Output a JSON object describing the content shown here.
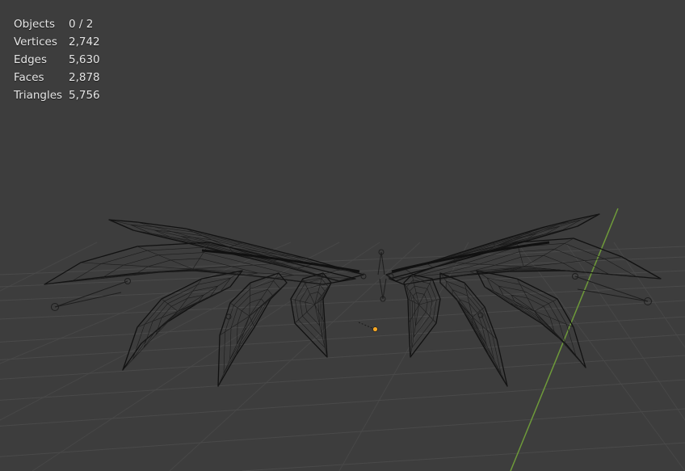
{
  "viewport": {
    "background": "#3d3d3d",
    "grid_color": "#4a4a4a",
    "y_axis_color": "#6e9a3a",
    "origin_color": "#f5a623"
  },
  "statistics": [
    {
      "label": "Objects",
      "value": "0 / 2"
    },
    {
      "label": "Vertices",
      "value": "2,742"
    },
    {
      "label": "Edges",
      "value": "5,630"
    },
    {
      "label": "Faces",
      "value": "2,878"
    },
    {
      "label": "Triangles",
      "value": "5,756"
    }
  ]
}
